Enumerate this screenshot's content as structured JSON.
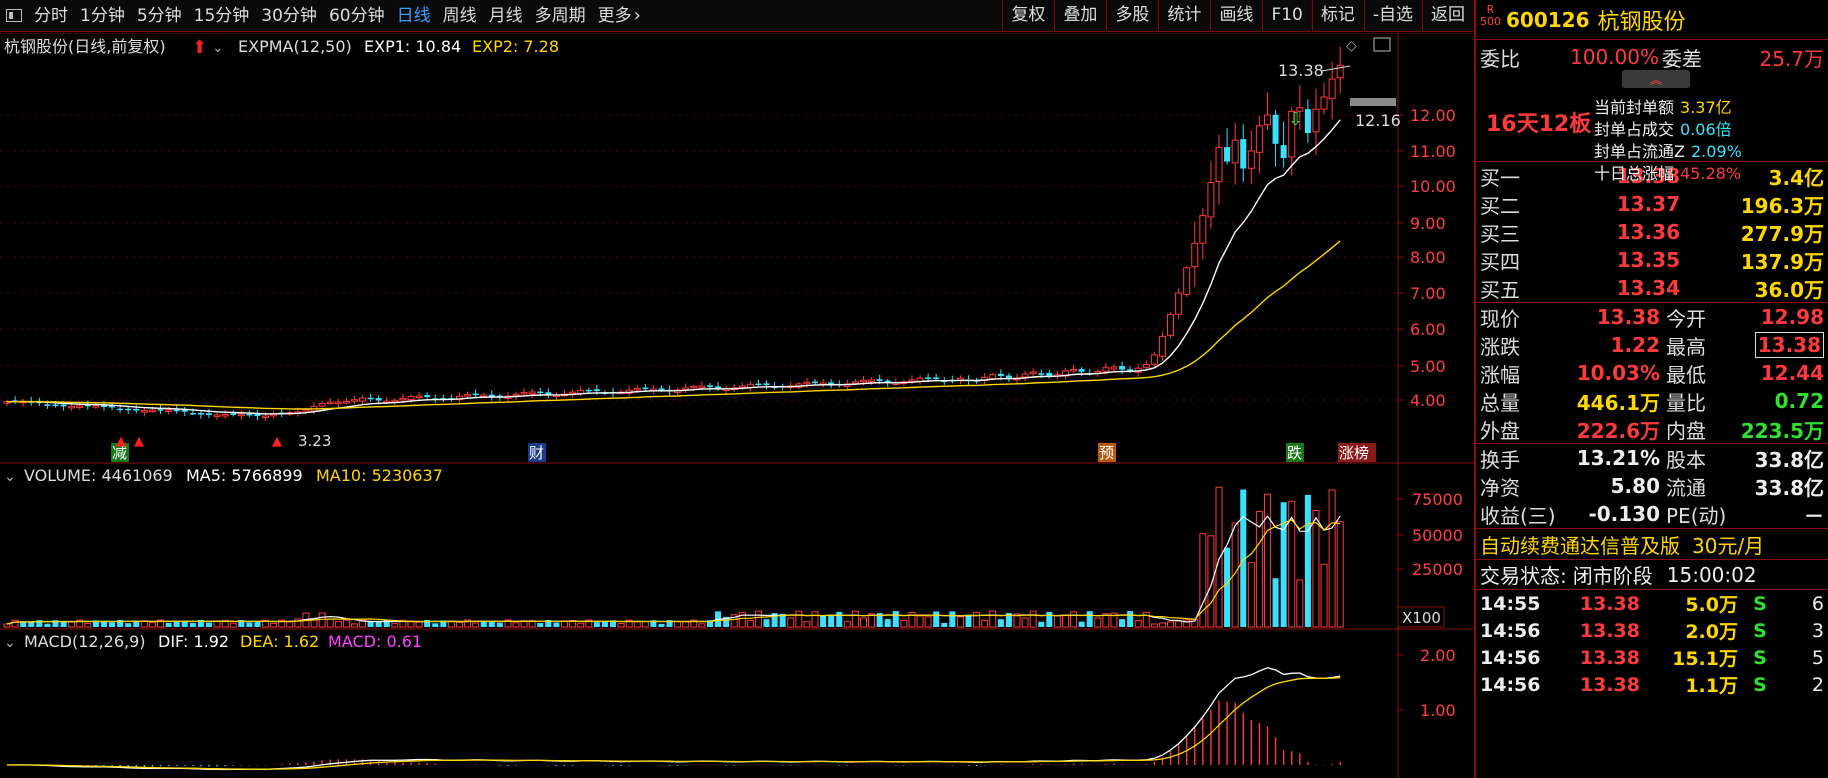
{
  "toolbar": {
    "periods": [
      "分时",
      "1分钟",
      "5分钟",
      "15分钟",
      "30分钟",
      "60分钟",
      "日线",
      "周线",
      "月线",
      "多周期",
      "更多"
    ],
    "active_period": "日线",
    "right_buttons": [
      "复权",
      "叠加",
      "多股",
      "统计",
      "画线",
      "F10",
      "标记",
      "-自选",
      "返回"
    ]
  },
  "main_chart": {
    "title": "杭钢股份(日线,前复权)",
    "indicator": "EXPMA(12,50)",
    "exp1": "EXP1: 10.84",
    "exp2": "EXP2: 7.28",
    "high_label": "13.38",
    "low_label": "3.23",
    "last_price_tag": "12.16",
    "price_ticks": [
      "12.00",
      "11.00",
      "10.00",
      "9.00",
      "8.00",
      "7.00",
      "6.00",
      "5.00",
      "4.00"
    ],
    "markers": [
      "减",
      "财",
      "预",
      "跌",
      "涨榜"
    ]
  },
  "volume_chart": {
    "title": "VOLUME: 4461069",
    "ma5": "MA5: 5766899",
    "ma10": "MA10: 5230637",
    "ticks": [
      "75000",
      "50000",
      "25000"
    ],
    "unit": "X100"
  },
  "macd_chart": {
    "title": "MACD(12,26,9)",
    "dif": "DIF: 1.92",
    "dea": "DEA: 1.62",
    "macd": "MACD: 0.61",
    "ticks": [
      "2.00",
      "1.00"
    ]
  },
  "panel": {
    "rank_badge_top": "R",
    "rank_badge_bottom": "500",
    "code": "600126",
    "name": "杭钢股份",
    "weibi_label": "委比",
    "weibi_value": "100.00%",
    "weicha_label": "委差",
    "weicha_value": "25.7万",
    "seal_tag": "16天12板",
    "seal": [
      {
        "k": "当前封单额",
        "v": "3.37亿",
        "color": "#ffd700"
      },
      {
        "k": "封单占成交",
        "v": "0.06倍",
        "color": "#3ae0ff"
      },
      {
        "k": "封单占流通Z",
        "v": "2.09%",
        "color": "#3ae0ff"
      },
      {
        "k": "十日总涨幅",
        "v": "45.28%",
        "color": "#ff3a3a"
      }
    ],
    "bids": [
      {
        "label": "买一",
        "price": "13.38",
        "vol": "3.4亿"
      },
      {
        "label": "买二",
        "price": "13.37",
        "vol": "196.3万"
      },
      {
        "label": "买三",
        "price": "13.36",
        "vol": "277.9万"
      },
      {
        "label": "买四",
        "price": "13.35",
        "vol": "137.9万"
      },
      {
        "label": "买五",
        "price": "13.34",
        "vol": "36.0万"
      }
    ],
    "quote": [
      {
        "l1": "现价",
        "v1": "13.38",
        "c1": "#ff3a3a",
        "l2": "今开",
        "v2": "12.98",
        "c2": "#ff3a3a"
      },
      {
        "l1": "涨跌",
        "v1": "1.22",
        "c1": "#ff3a3a",
        "l2": "最高",
        "v2": "13.38",
        "c2": "#ff3a3a"
      },
      {
        "l1": "涨幅",
        "v1": "10.03%",
        "c1": "#ff3a3a",
        "l2": "最低",
        "v2": "12.44",
        "c2": "#ff3a3a"
      },
      {
        "l1": "总量",
        "v1": "446.1万",
        "c1": "#ffd700",
        "l2": "量比",
        "v2": "0.72",
        "c2": "#2fe02f"
      },
      {
        "l1": "外盘",
        "v1": "222.6万",
        "c1": "#ff3a3a",
        "l2": "内盘",
        "v2": "223.5万",
        "c2": "#2fe02f"
      }
    ],
    "stats": [
      {
        "l1": "换手",
        "v1": "13.21%",
        "l2": "股本",
        "v2": "33.8亿"
      },
      {
        "l1": "净资",
        "v1": "5.80",
        "l2": "流通",
        "v2": "33.8亿"
      },
      {
        "l1": "收益(三)",
        "v1": "-0.130",
        "l2": "PE(动)",
        "v2": "－"
      }
    ],
    "ad_text": "自动续费通达信普及版",
    "ad_price": "30元/月",
    "trade_status_label": "交易状态:",
    "trade_status": "闭市阶段",
    "trade_time": "15:00:02",
    "trades": [
      {
        "time": "14:55",
        "price": "13.38",
        "vol": "5.0万",
        "side": "S",
        "n": "6"
      },
      {
        "time": "14:56",
        "price": "13.38",
        "vol": "2.0万",
        "side": "S",
        "n": "3"
      },
      {
        "time": "14:56",
        "price": "13.38",
        "vol": "15.1万",
        "side": "S",
        "n": "5"
      },
      {
        "time": "14:56",
        "price": "13.38",
        "vol": "1.1万",
        "side": "S",
        "n": "2"
      }
    ]
  },
  "colors": {
    "up": "#ff3a3a",
    "down": "#3ae0ff",
    "ma_white": "#ffffff",
    "ma_yellow": "#ffd700",
    "grid": "#8a1010"
  }
}
